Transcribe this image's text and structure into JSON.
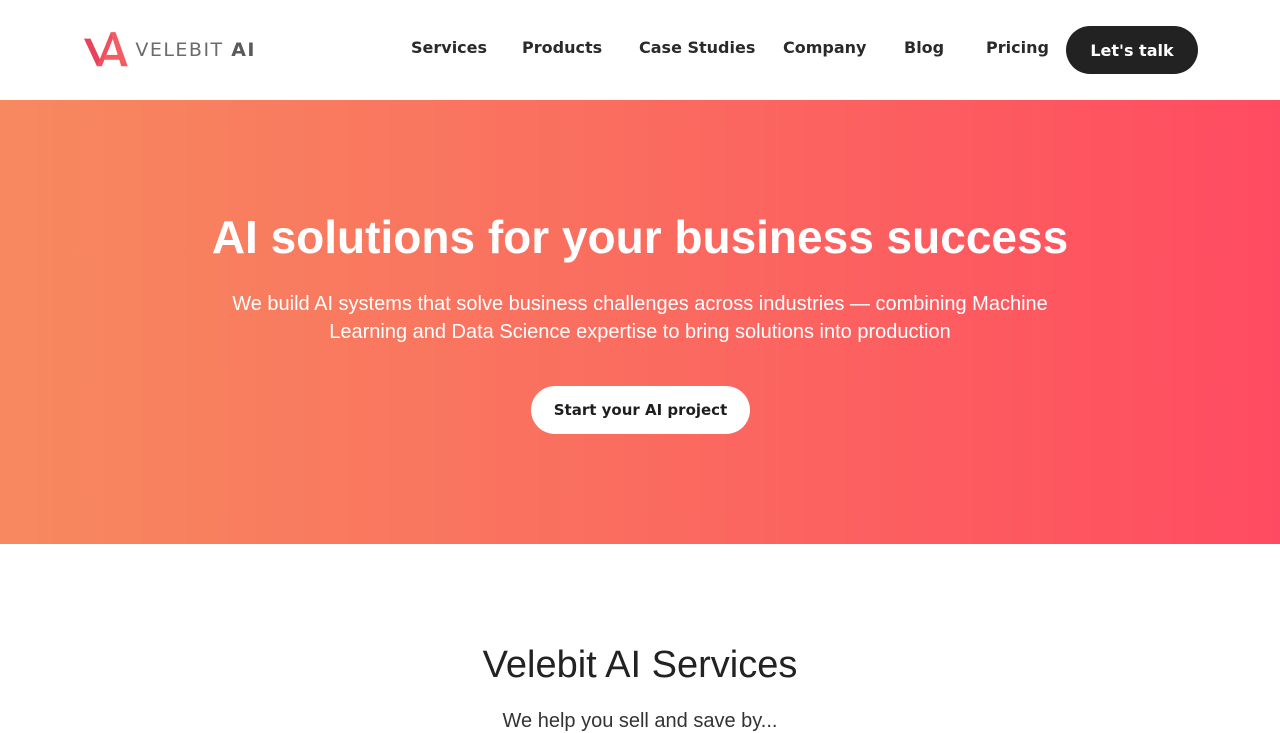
{
  "header": {
    "logo": {
      "text": "VELEBIT",
      "text_suffix": "AI"
    },
    "nav": [
      {
        "label": "Services"
      },
      {
        "label": "Products"
      },
      {
        "label": "Case Studies"
      },
      {
        "label": "Company"
      },
      {
        "label": "Blog"
      },
      {
        "label": "Pricing"
      }
    ],
    "cta_label": "Let's talk"
  },
  "hero": {
    "title": "AI solutions for your business success",
    "subtitle": "We build AI systems that solve business challenges across industries — combining Machine Learning and Data Science expertise to bring solutions into production",
    "button_label": "Start your AI project"
  },
  "services": {
    "title": "Velebit AI Services",
    "subtitle_partial": "We help you sell and save by..."
  },
  "colors": {
    "brand_red": "#f0455c",
    "gradient_start": "#f7895f",
    "gradient_end": "#ff4b61",
    "dark": "#222222"
  }
}
